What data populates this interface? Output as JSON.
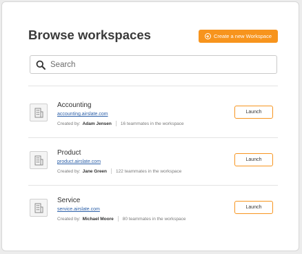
{
  "page": {
    "title": "Browse workspaces",
    "create_button_label": "Create a new Workspace"
  },
  "search": {
    "placeholder": "Search"
  },
  "workspaces": [
    {
      "name": "Accounting",
      "url": "accounting.airslate.com",
      "created_by_label": "Created by:",
      "creator": "Adam Jensen",
      "teammates": "16 teammates in the workspace",
      "launch_label": "Launch"
    },
    {
      "name": "Product",
      "url": "product.airslate.com",
      "created_by_label": "Created by:",
      "creator": "Jane Green",
      "teammates": "122 teammates in the workspace",
      "launch_label": "Launch"
    },
    {
      "name": "Service",
      "url": "service.airslate.com",
      "created_by_label": "Created by:",
      "creator": "Michael Moore",
      "teammates": "80 teammates in the workspace",
      "launch_label": "Launch"
    }
  ],
  "colors": {
    "accent": "#f7941d",
    "link": "#2b5fa8"
  },
  "icons": {
    "create": "plus-circle-icon",
    "search": "search-icon",
    "workspace": "building-icon"
  }
}
